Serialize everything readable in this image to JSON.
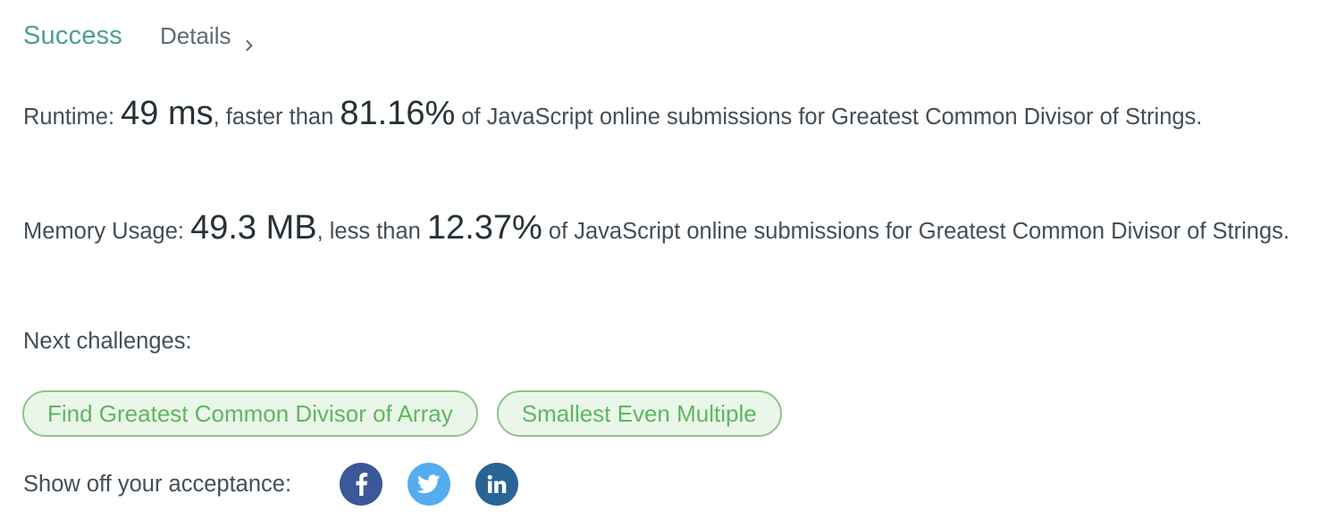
{
  "header": {
    "status": "Success",
    "details_label": "Details"
  },
  "runtime": {
    "label": "Runtime: ",
    "value": "49 ms",
    "comparison": ", faster than ",
    "percent": "81.16%",
    "suffix": " of JavaScript online submissions for Greatest Common Divisor of Strings."
  },
  "memory": {
    "label": "Memory Usage: ",
    "value": "49.3 MB",
    "comparison": ", less than ",
    "percent": "12.37%",
    "suffix": " of JavaScript online submissions for Greatest Common Divisor of Strings."
  },
  "next": {
    "label": "Next challenges:",
    "items": [
      {
        "label": "Find Greatest Common Divisor of Array"
      },
      {
        "label": "Smallest Even Multiple"
      }
    ]
  },
  "share": {
    "label": "Show off your acceptance:",
    "icons": [
      {
        "name": "facebook-icon",
        "color": "#3b5998"
      },
      {
        "name": "twitter-icon",
        "color": "#55acee"
      },
      {
        "name": "linkedin-icon",
        "color": "#2a6496"
      }
    ]
  },
  "colors": {
    "success": "#4aa090",
    "pill_border": "#8bc58a",
    "pill_bg": "#ebf6ea",
    "pill_text": "#5cb85c"
  }
}
